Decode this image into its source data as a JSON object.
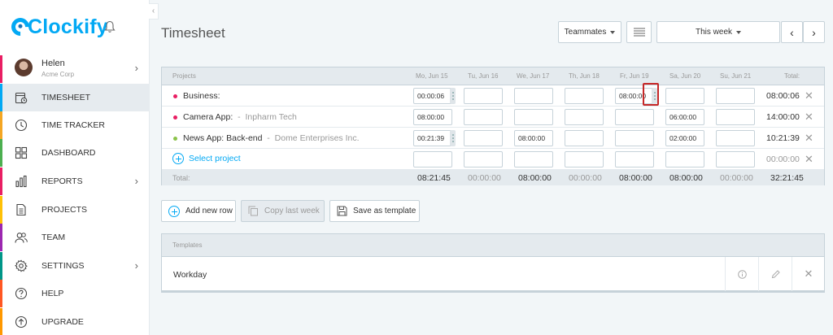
{
  "app": {
    "logo": "Clockify"
  },
  "user": {
    "name": "Helen",
    "org": "Acme Corp"
  },
  "nav": [
    {
      "key": "timesheet",
      "label": "TIMESHEET",
      "color": "#03a9f4",
      "active": true
    },
    {
      "key": "time-tracker",
      "label": "TIME TRACKER",
      "color": "#f4a623"
    },
    {
      "key": "dashboard",
      "label": "DASHBOARD",
      "color": "#4caf50"
    },
    {
      "key": "reports",
      "label": "REPORTS",
      "color": "#e91e63"
    },
    {
      "key": "projects",
      "label": "PROJECTS",
      "color": "#ffc107"
    },
    {
      "key": "team",
      "label": "TEAM",
      "color": "#9c27b0"
    },
    {
      "key": "settings",
      "label": "SETTINGS",
      "color": "#009688"
    },
    {
      "key": "help",
      "label": "HELP",
      "color": "#ff5722"
    },
    {
      "key": "upgrade",
      "label": "UPGRADE",
      "color": "#ff9800"
    }
  ],
  "header": {
    "title": "Timesheet",
    "teammates_label": "Teammates",
    "week_label": "This week"
  },
  "table": {
    "headers": [
      "Projects",
      "Mo, Jun 15",
      "Tu, Jun 16",
      "We, Jun 17",
      "Th, Jun 18",
      "Fr, Jun 19",
      "Sa, Jun 20",
      "Su, Jun 21",
      "Total:"
    ],
    "rows": [
      {
        "project": "Business:",
        "client": "",
        "dot": "#e91e63",
        "cells": [
          "00:00:06",
          "",
          "",
          "",
          "08:00:00",
          "",
          ""
        ],
        "total": "08:00:06"
      },
      {
        "project": "Camera App:",
        "client": "Inpharm Tech",
        "dot": "#e91e63",
        "cells": [
          "08:00:00",
          "",
          "",
          "",
          "",
          "06:00:00",
          ""
        ],
        "total": "14:00:00"
      },
      {
        "project": "News App: Back-end",
        "client": "Dome Enterprises Inc.",
        "dot": "#8bc34a",
        "cells": [
          "00:21:39",
          "",
          "08:00:00",
          "",
          "",
          "02:00:00",
          ""
        ],
        "total": "10:21:39"
      }
    ],
    "select_project_label": "Select project",
    "empty_total": "00:00:00",
    "footer_label": "Total:",
    "footer_values": [
      "08:21:45",
      "00:00:00",
      "08:00:00",
      "00:00:00",
      "08:00:00",
      "08:00:00",
      "00:00:00"
    ],
    "footer_total": "32:21:45"
  },
  "actions": {
    "add_row": "Add new row",
    "copy_week": "Copy last week",
    "save_template": "Save as template"
  },
  "templates": {
    "header": "Templates",
    "items": [
      {
        "name": "Workday"
      }
    ]
  }
}
